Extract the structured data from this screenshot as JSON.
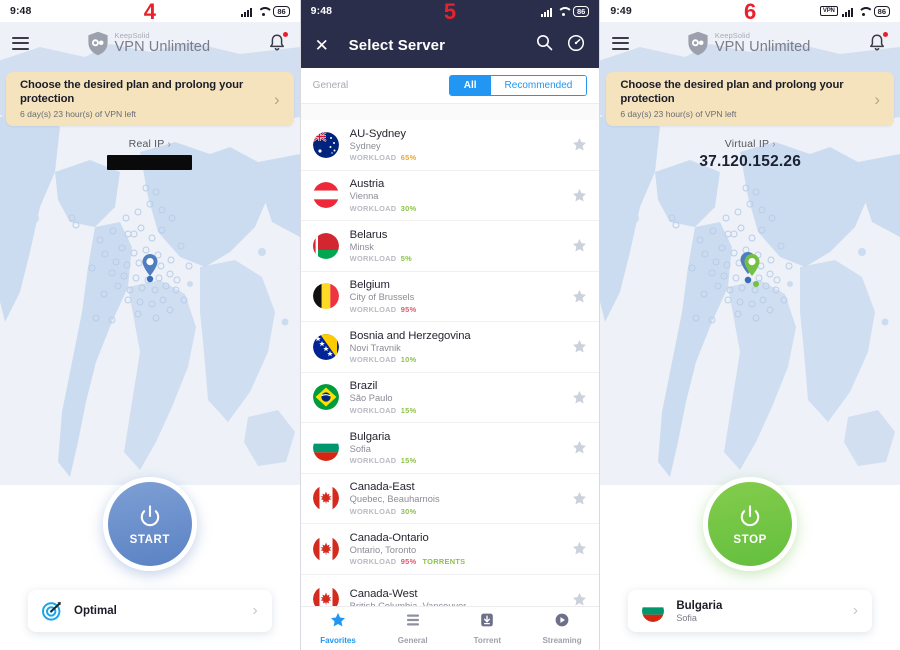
{
  "panels": [
    {
      "marker": "4",
      "status": {
        "time": "9:48",
        "battery": "86",
        "vpn_icon": false
      },
      "header": {
        "brand_small": "KeepSolid",
        "brand_large": "VPN Unlimited",
        "menu_icon": "hamburger-icon",
        "bell_icon": "bell-icon"
      },
      "promo": {
        "title": "Choose the desired plan and prolong your protection",
        "subtitle": "6 day(s) 23 hour(s) of VPN left",
        "chevron": "›"
      },
      "ip": {
        "label": "Real IP",
        "chevron": "›",
        "value": "",
        "redacted": true
      },
      "power": {
        "label": "START",
        "state": "disconnected",
        "color": "#5b82c4"
      },
      "bottom_card": {
        "type": "optimal",
        "title": "Optimal",
        "subtitle": "",
        "chevron": "›"
      }
    },
    {
      "marker": "5",
      "status": {
        "time": "9:48",
        "battery": "86",
        "vpn_icon": false
      },
      "header": {
        "title": "Select Server",
        "close_icon": "close-icon",
        "search_icon": "search-icon",
        "speed_icon": "speedometer-icon"
      },
      "filter": {
        "group_label": "General",
        "segments": [
          {
            "label": "All",
            "selected": true
          },
          {
            "label": "Recommended",
            "selected": false
          }
        ]
      },
      "servers": [
        {
          "name": "AU-Sydney",
          "city": "Sydney",
          "workload_label": "WORKLOAD",
          "workload": "65%",
          "workload_color": "#f5a623",
          "tag": "",
          "flag": "au",
          "starred": false
        },
        {
          "name": "Austria",
          "city": "Vienna",
          "workload_label": "WORKLOAD",
          "workload": "30%",
          "workload_color": "#8bc34a",
          "tag": "",
          "flag": "at",
          "starred": false
        },
        {
          "name": "Belarus",
          "city": "Minsk",
          "workload_label": "WORKLOAD",
          "workload": "5%",
          "workload_color": "#8bc34a",
          "tag": "",
          "flag": "by",
          "starred": false
        },
        {
          "name": "Belgium",
          "city": "City of Brussels",
          "workload_label": "WORKLOAD",
          "workload": "95%",
          "workload_color": "#e8556d",
          "tag": "",
          "flag": "be",
          "starred": false
        },
        {
          "name": "Bosnia and Herzegovina",
          "city": "Novi Travnik",
          "workload_label": "WORKLOAD",
          "workload": "10%",
          "workload_color": "#8bc34a",
          "tag": "",
          "flag": "ba",
          "starred": false
        },
        {
          "name": "Brazil",
          "city": "São Paulo",
          "workload_label": "WORKLOAD",
          "workload": "15%",
          "workload_color": "#8bc34a",
          "tag": "",
          "flag": "br",
          "starred": false
        },
        {
          "name": "Bulgaria",
          "city": "Sofia",
          "workload_label": "WORKLOAD",
          "workload": "15%",
          "workload_color": "#8bc34a",
          "tag": "",
          "flag": "bg",
          "starred": false
        },
        {
          "name": "Canada-East",
          "city": "Quebec, Beauharnois",
          "workload_label": "WORKLOAD",
          "workload": "30%",
          "workload_color": "#8bc34a",
          "tag": "",
          "flag": "ca",
          "starred": false
        },
        {
          "name": "Canada-Ontario",
          "city": "Ontario, Toronto",
          "workload_label": "WORKLOAD",
          "workload": "95%",
          "workload_color": "#e8556d",
          "tag": "TORRENTS",
          "flag": "ca",
          "starred": false
        },
        {
          "name": "Canada-West",
          "city": "British Columbia, Vancouver",
          "workload_label": "WORKLOAD",
          "workload": "",
          "workload_color": "#8bc34a",
          "tag": "",
          "flag": "ca",
          "starred": false
        }
      ],
      "tabs": [
        {
          "label": "Favorites",
          "icon": "star-icon",
          "active": true
        },
        {
          "label": "General",
          "icon": "list-icon",
          "active": false
        },
        {
          "label": "Torrent",
          "icon": "torrent-icon",
          "active": false
        },
        {
          "label": "Streaming",
          "icon": "play-icon",
          "active": false
        }
      ]
    },
    {
      "marker": "6",
      "status": {
        "time": "9:49",
        "battery": "86",
        "vpn_icon": true,
        "vpn_label": "VPN"
      },
      "header": {
        "brand_small": "KeepSolid",
        "brand_large": "VPN Unlimited",
        "menu_icon": "hamburger-icon",
        "bell_icon": "bell-icon"
      },
      "promo": {
        "title": "Choose the desired plan and prolong your protection",
        "subtitle": "6 day(s) 23 hour(s) of VPN left",
        "chevron": "›"
      },
      "ip": {
        "label": "Virtual IP",
        "chevron": "›",
        "value": "37.120.152.26",
        "redacted": false
      },
      "power": {
        "label": "STOP",
        "state": "connected",
        "color": "#64bf3e"
      },
      "bottom_card": {
        "type": "server",
        "title": "Bulgaria",
        "subtitle": "Sofia",
        "flag": "bg",
        "chevron": "›"
      }
    }
  ],
  "colors": {
    "marker_red": "#e8212a",
    "promo_bg": "#f4e3bd",
    "map_bg": "#eef2f8",
    "map_land": "#ccdcf0",
    "dark_header": "#2b2e4a",
    "accent_blue": "#2196f3",
    "start_blue": "#5b82c4",
    "stop_green": "#64bf3e"
  }
}
